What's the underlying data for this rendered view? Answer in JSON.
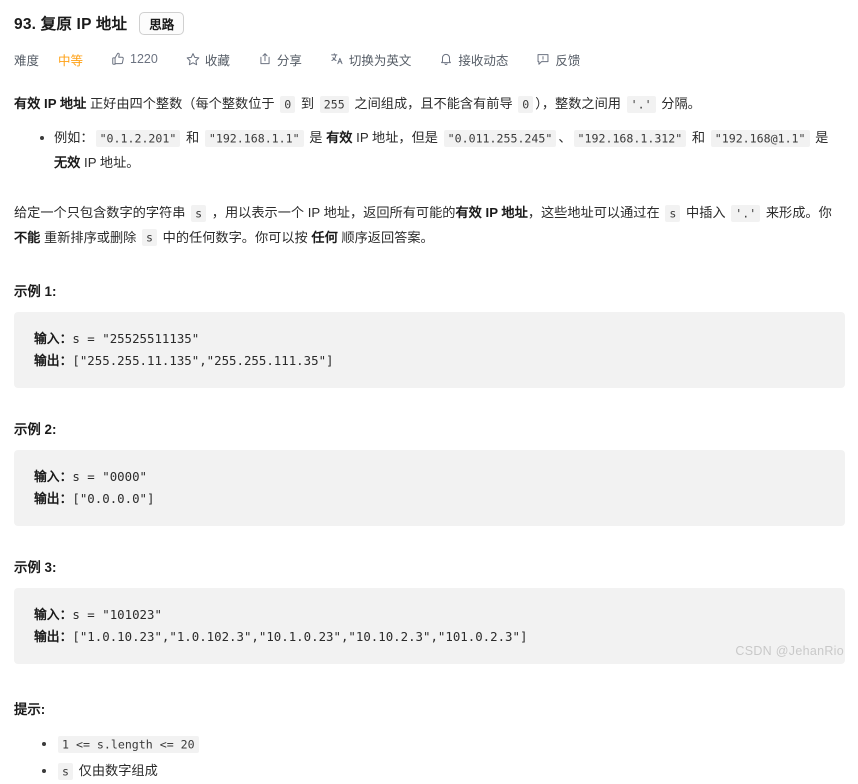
{
  "header": {
    "title": "93. 复原 IP 地址",
    "idea_badge": "思路"
  },
  "toolbar": {
    "difficulty_label": "难度",
    "difficulty_value": "中等",
    "like_count": "1220",
    "favorite_label": "收藏",
    "share_label": "分享",
    "translate_label": "切换为英文",
    "subscribe_label": "接收动态",
    "feedback_label": "反馈",
    "icons": {
      "thumbs_up": "thumbs-up-icon",
      "star": "star-icon",
      "share": "share-icon",
      "translate": "translate-icon",
      "bell": "bell-icon",
      "feedback": "feedback-icon"
    }
  },
  "description": {
    "line1_a": "有效 IP 地址",
    "line1_b": " 正好由四个整数（每个整数位于 ",
    "code_0": "0",
    "line1_c": " 到 ",
    "code_255": "255",
    "line1_d": " 之间组成，且不能含有前导 ",
    "code_0b": "0",
    "line1_e": "），整数之间用 ",
    "code_dot": "'.'",
    "line1_f": " 分隔。",
    "bullet_prefix": "例如：",
    "ex_valid_1": "\"0.1.2.201\"",
    "ex_and_1": " 和 ",
    "ex_valid_2": "\"192.168.1.1\"",
    "ex_is": " 是 ",
    "ex_valid_word": "有效",
    "ex_ip_addr": " IP 地址，但是 ",
    "ex_invalid_1": "\"0.011.255.245\"",
    "ex_pause": "、",
    "ex_invalid_2": "\"192.168.1.312\"",
    "ex_and_2": " 和 ",
    "ex_invalid_3": "\"192.168@1.1\"",
    "ex_is_2": " 是 ",
    "ex_invalid_word": "无效",
    "ex_tail": " IP 地址。"
  },
  "problem": {
    "p_a": "给定一个只包含数字的字符串 ",
    "code_s1": "s",
    "p_b": " ，用以表示一个 IP 地址，返回所有可能的",
    "p_bold_valid": "有效 IP 地址",
    "p_c": "，这些地址可以通过在 ",
    "code_s2": "s",
    "p_d": " 中插入 ",
    "code_dot": "'.'",
    "p_e": " 来形成。你 ",
    "p_bold_cannot": "不能",
    "p_f": " 重新排序或删除 ",
    "code_s3": "s",
    "p_g": " 中的任何数字。你可以按 ",
    "p_bold_any": "任何",
    "p_h": " 顺序返回答案。"
  },
  "examples": [
    {
      "title": "示例 1:",
      "input_label": "输入：",
      "input_value": "s = \"25525511135\"",
      "output_label": "输出：",
      "output_value": "[\"255.255.11.135\",\"255.255.111.35\"]"
    },
    {
      "title": "示例 2:",
      "input_label": "输入：",
      "input_value": "s = \"0000\"",
      "output_label": "输出：",
      "output_value": "[\"0.0.0.0\"]"
    },
    {
      "title": "示例 3:",
      "input_label": "输入：",
      "input_value": "s = \"101023\"",
      "output_label": "输出：",
      "output_value": "[\"1.0.10.23\",\"1.0.102.3\",\"10.1.0.23\",\"10.10.2.3\",\"101.0.2.3\"]"
    }
  ],
  "hints": {
    "title": "提示:",
    "items": [
      {
        "code": "1 <= s.length <= 20",
        "text": ""
      },
      {
        "code": "s",
        "text": " 仅由数字组成"
      }
    ]
  },
  "watermark": "CSDN @JehanRio",
  "colors": {
    "accent_orange": "#ffa116",
    "code_bg": "#f2f2f2",
    "text": "#2b2b2b",
    "muted": "#555c66"
  }
}
